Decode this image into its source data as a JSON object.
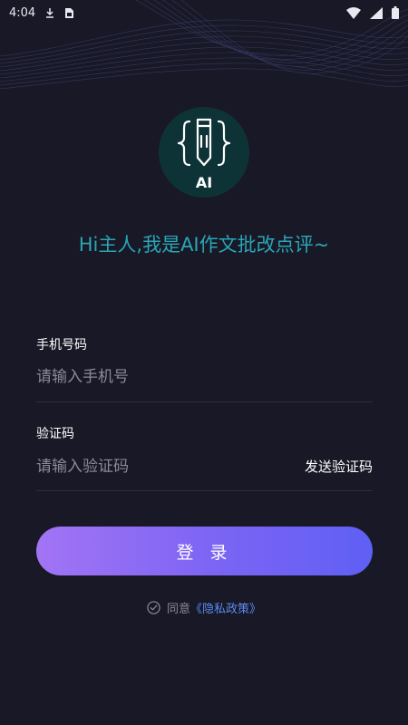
{
  "status_bar": {
    "time": "4:04"
  },
  "logo": {
    "text": "AI"
  },
  "greeting": "Hi主人,我是AI作文批改点评~",
  "phone": {
    "label": "手机号码",
    "placeholder": "请输入手机号",
    "value": ""
  },
  "code": {
    "label": "验证码",
    "placeholder": "请输入验证码",
    "value": "",
    "send_label": "发送验证码"
  },
  "login_label": "登 录",
  "agreement": {
    "prefix": "同意",
    "link": "《隐私政策》",
    "checked": false
  },
  "colors": {
    "background": "#181826",
    "accent_teal": "#2aa6b5",
    "gradient_start": "#a274f4",
    "gradient_end": "#5f60f4",
    "link": "#5b8bf0"
  }
}
